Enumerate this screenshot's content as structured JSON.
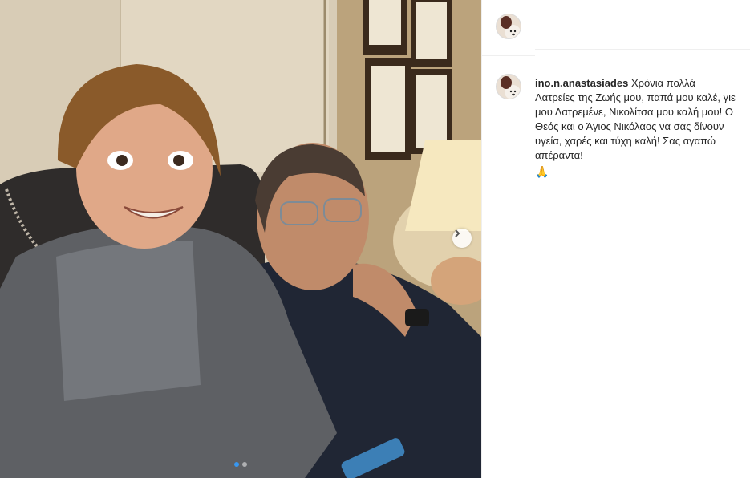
{
  "post": {
    "username": "ino.n.anastasiades",
    "caption": "Χρόνια πολλά Λατρείες της Ζωής μου, παπά μου καλέ, γιε μου Λατρεμένε, Νικολίτσα μου καλή μου! Ο Θεός και ο Άγιος Νικόλαος να σας δίνουν υγεία, χαρές και τύχη καλή! Σας αγαπώ απέραντα!",
    "emoji": "🙏"
  },
  "carousel": {
    "current": 1,
    "total": 2,
    "next_icon": "chevron-right-icon"
  },
  "colors": {
    "accent": "#3897f0",
    "border": "#efefef",
    "text": "#262626"
  }
}
